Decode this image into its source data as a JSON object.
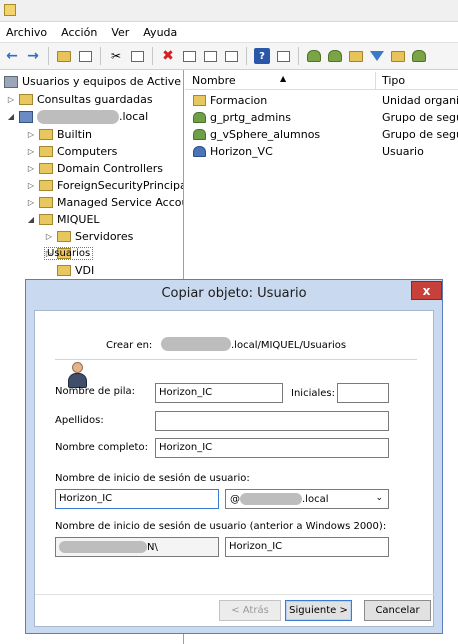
{
  "menu": {
    "items": [
      "Archivo",
      "Acción",
      "Ver",
      "Ayuda"
    ]
  },
  "tree": {
    "root_label": "Usuarios y equipos de Active Dir",
    "saved_queries": "Consultas guardadas",
    "domain_suffix": ".local",
    "children": [
      {
        "label": "Builtin"
      },
      {
        "label": "Computers"
      },
      {
        "label": "Domain Controllers"
      },
      {
        "label": "ForeignSecurityPrincipals"
      },
      {
        "label": "Managed Service Accour"
      },
      {
        "label": "MIQUEL"
      }
    ],
    "miquel_children": [
      {
        "label": "Servidores"
      },
      {
        "label": "Usuarios"
      },
      {
        "label": "VDI"
      }
    ]
  },
  "list": {
    "col_name": "Nombre",
    "col_type": "Tipo",
    "rows": [
      {
        "name": "Formacion",
        "type": "Unidad organi...",
        "icon": "folder-icon"
      },
      {
        "name": "g_prtg_admins",
        "type": "Grupo de segu...",
        "icon": "group-icon"
      },
      {
        "name": "g_vSphere_alumnos",
        "type": "Grupo de segu...",
        "icon": "group-icon"
      },
      {
        "name": "Horizon_VC",
        "type": "Usuario",
        "icon": "user-icon"
      }
    ]
  },
  "dialog": {
    "title": "Copiar objeto: Usuario",
    "create_in_label": "Crear en:",
    "create_in_path": ".local/MIQUEL/Usuarios",
    "first_name_label": "Nombre de pila:",
    "first_name_value": "Horizon_IC",
    "initials_label": "Iniciales:",
    "initials_value": "",
    "last_name_label": "Apellidos:",
    "last_name_value": "",
    "full_name_label": "Nombre completo:",
    "full_name_value": "Horizon_IC",
    "logon_label": "Nombre de inicio de sesión de usuario:",
    "logon_value": "Horizon_IC",
    "upn_prefix": "@",
    "upn_suffix": ".local",
    "pre2000_label": "Nombre de inicio de sesión de usuario (anterior a Windows 2000):",
    "pre2000_domain_suffix": "N\\",
    "pre2000_value": "Horizon_IC",
    "back_button": "< Atrás",
    "next_button": "Siguiente >",
    "cancel_button": "Cancelar",
    "close_glyph": "x"
  }
}
